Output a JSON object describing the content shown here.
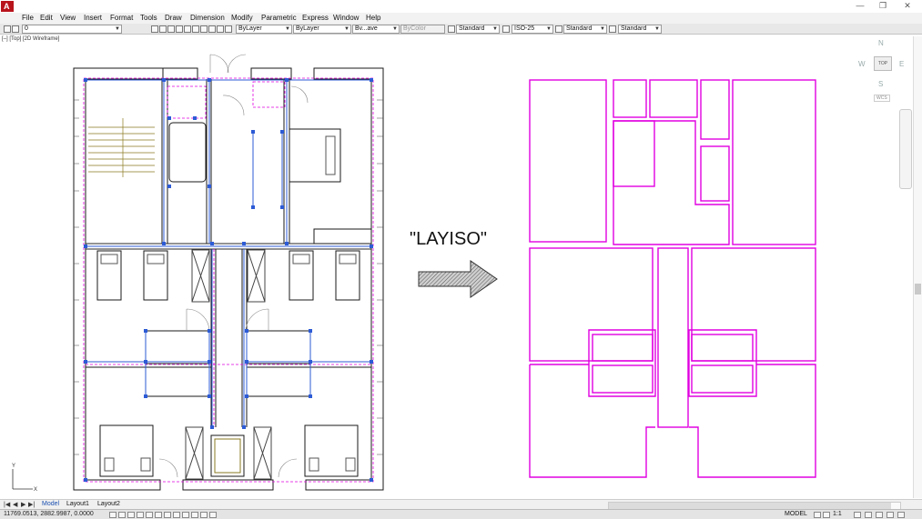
{
  "window": {
    "app_icon_letter": "A",
    "controls": [
      "—",
      "❐",
      "✕"
    ]
  },
  "menu": [
    "File",
    "Edit",
    "View",
    "Insert",
    "Format",
    "Tools",
    "Draw",
    "Dimension",
    "Modify",
    "Parametric",
    "Express",
    "Window",
    "Help"
  ],
  "toolbar": {
    "layer_value": "0",
    "color_value": "ByLayer",
    "linetype_value": "ByLayer",
    "lineweight_value": "Bv...ave",
    "plotstyle_value": "ByColor",
    "text_style": "Standard",
    "dim_style": "ISO-25",
    "table_style": "Standard",
    "mleader_style": "Standard"
  },
  "viewport_label": "[–] [Top] [2D Wireframe]",
  "viewcube": {
    "north": "N",
    "west": "W",
    "east": "E",
    "south": "S",
    "face": "TOP",
    "wcs": "WCS"
  },
  "annotation": {
    "command_text": "\"LAYISO\""
  },
  "tabs": {
    "nav": [
      "|◀",
      "◀",
      "▶",
      "▶|"
    ],
    "model": "Model",
    "layout1": "Layout1",
    "layout2": "Layout2"
  },
  "status": {
    "coords": "11769.0513, 2882.9987, 0.0000",
    "model": "MODEL",
    "scale": "1:1"
  },
  "colors": {
    "wall": "#1a1a1a",
    "dim_blue": "#2d5bd6",
    "magenta": "#e000e0",
    "menu_bg": "#f2f2f2"
  }
}
